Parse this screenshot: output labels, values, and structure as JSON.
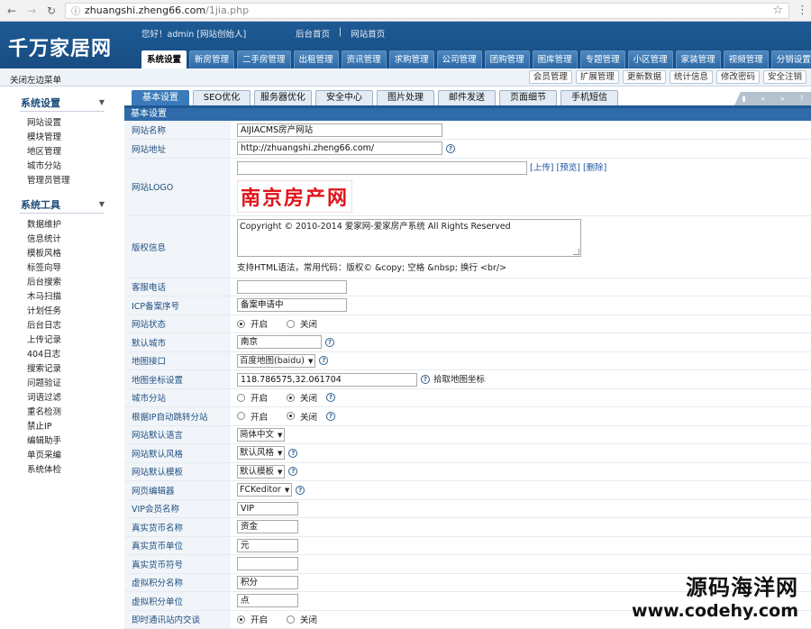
{
  "browser": {
    "url_host": "zhuangshi.zheng66.com",
    "url_path": "/1jia.php"
  },
  "header": {
    "logo_text": "千万家居网",
    "welcome": "您好！admin [网站创始人]",
    "links": [
      "后台首页",
      "|",
      "网站首页"
    ],
    "nav_tabs": [
      "系统设置",
      "新房管理",
      "二手房管理",
      "出租管理",
      "资讯管理",
      "求购管理",
      "公司管理",
      "团购管理",
      "图库管理",
      "专题管理",
      "小区管理",
      "家装管理",
      "视频管理",
      "分销设置"
    ],
    "active_tab": 0
  },
  "subbar": {
    "close_menu": "关闭左边菜单",
    "buttons": [
      "会员管理",
      "扩展管理",
      "更新数据",
      "统计信息",
      "修改密码",
      "安全注销"
    ]
  },
  "sidebar": {
    "groups": [
      {
        "title": "系统设置",
        "items": [
          "网站设置",
          "模块管理",
          "地区管理",
          "城市分站",
          "管理员管理"
        ]
      },
      {
        "title": "系统工具",
        "items": [
          "数据维护",
          "信息统计",
          "模板风格",
          "标签向导",
          "后台搜索",
          "木马扫描",
          "计划任务",
          "后台日志",
          "上传记录",
          "404日志",
          "搜索记录",
          "问题验证",
          "词语过滤",
          "重名检测",
          "禁止IP",
          "编辑助手",
          "单页采编",
          "系统体检"
        ]
      }
    ]
  },
  "content_tabs": [
    "基本设置",
    "SEO优化",
    "服务器优化",
    "安全中心",
    "图片处理",
    "邮件发送",
    "页面细节",
    "手机短信"
  ],
  "active_content_tab": 0,
  "tab_tools": [
    "▮",
    "«",
    "»",
    "?"
  ],
  "section_title": "基本设置",
  "form": {
    "site_name": {
      "label": "网站名称",
      "value": "AIJIACMS房产网站"
    },
    "site_url": {
      "label": "网站地址",
      "value": "http://zhuangshi.zheng66.com/"
    },
    "site_logo": {
      "label": "网站LOGO",
      "value": "",
      "links": [
        "[上传]",
        "[预览]",
        "[删除]"
      ],
      "logo_text": "南京房产网"
    },
    "copyright": {
      "label": "版权信息",
      "value": "Copyright © 2010-2014 爱家网-爱家房产系统 All Rights Reserved",
      "note": "支持HTML语法，常用代码：版权© &copy; 空格 &nbsp; 换行 <br/>"
    },
    "phone": {
      "label": "客服电话",
      "value": ""
    },
    "icp": {
      "label": "ICP备案序号",
      "value": "备案申请中"
    },
    "site_status": {
      "label": "网站状态",
      "options": [
        "开启",
        "关闭"
      ],
      "selected": 0
    },
    "default_city": {
      "label": "默认城市",
      "value": "南京"
    },
    "map_api": {
      "label": "地图接口",
      "value": "百度地图(baidu)"
    },
    "map_coords": {
      "label": "地图坐标设置",
      "value": "118.786575,32.061704",
      "note": "拾取地图坐标"
    },
    "city_branch": {
      "label": "城市分站",
      "options": [
        "开启",
        "关闭"
      ],
      "selected": 1
    },
    "ip_redirect": {
      "label": "根据IP自动跳转分站",
      "options": [
        "开启",
        "关闭"
      ],
      "selected": 1
    },
    "language": {
      "label": "网站默认语言",
      "value": "简体中文"
    },
    "style": {
      "label": "网站默认风格",
      "value": "默认风格"
    },
    "template": {
      "label": "网站默认模板",
      "value": "默认模板"
    },
    "editor": {
      "label": "网页编辑器",
      "value": "FCKeditor"
    },
    "vip_name": {
      "label": "VIP会员名称",
      "value": "VIP"
    },
    "currency_name": {
      "label": "真实货币名称",
      "value": "资金"
    },
    "currency_unit": {
      "label": "真实货币单位",
      "value": "元"
    },
    "currency_symbol": {
      "label": "真实货币符号",
      "value": ""
    },
    "credit_name": {
      "label": "虚拟积分名称",
      "value": "积分"
    },
    "credit_unit": {
      "label": "虚拟积分单位",
      "value": "点"
    },
    "im_chat": {
      "label": "即时通讯站内交谈",
      "options": [
        "开启",
        "关闭"
      ],
      "selected": 0
    }
  },
  "watermark": {
    "line1": "源码海洋网",
    "line2": "www.codehy.com"
  },
  "colors": {
    "header_blue": "#1e5a94",
    "tab_active": "#3b7bbb",
    "label_text": "#1f4e80",
    "logo_red": "#e0141b"
  }
}
